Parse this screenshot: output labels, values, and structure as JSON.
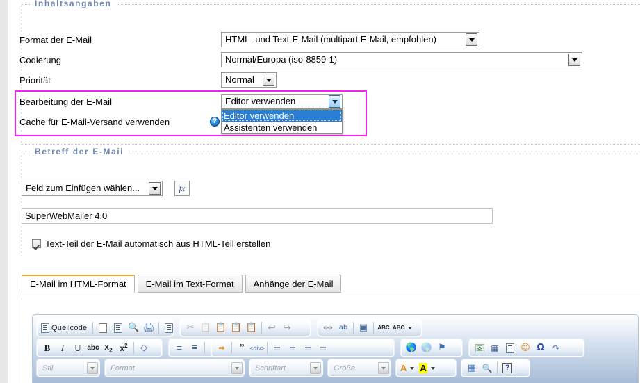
{
  "colors": {
    "legend_text": "#7089ae",
    "highlight_border": "#f51ff5",
    "dropdown_selected_bg": "#2a7fd4",
    "active_tab_top": "#f2a32b",
    "toolbar_gradient_top": "#fdfeff",
    "toolbar_gradient_bottom": "#a7bbd6"
  },
  "sections": {
    "content": {
      "legend": "Inhaltsangaben",
      "rows": [
        {
          "label": "Format der E-Mail",
          "value": "HTML- und Text-E-Mail (multipart E-Mail, empfohlen)"
        },
        {
          "label": "Codierung",
          "value": "Normal/Europa (iso-8859-1)"
        },
        {
          "label": "Priorität",
          "value": "Normal"
        },
        {
          "label": "Bearbeitung der E-Mail",
          "value": "Editor verwenden"
        },
        {
          "label": "Cache für E-Mail-Versand verwenden",
          "value": ""
        }
      ],
      "help_icon": "help-icon",
      "help_glyph": "?",
      "open_dropdown": {
        "selected": "Editor verwenden",
        "options": [
          "Editor verwenden",
          "Assistenten verwenden"
        ]
      }
    },
    "subject": {
      "legend": "Betreff der E-Mail",
      "field_select": {
        "value": "Feld zum Einfügen wählen...",
        "placeholder": "Feld zum Einfügen wählen..."
      },
      "fx_button_label": "fx",
      "subject_input": {
        "value": "SuperWebMailer 4.0",
        "placeholder": ""
      },
      "checkbox": {
        "label": "Text-Teil der E-Mail automatisch aus HTML-Teil erstellen",
        "checked": true
      }
    }
  },
  "tabs": [
    {
      "label": "E-Mail im HTML-Format",
      "active": true
    },
    {
      "label": "E-Mail im Text-Format",
      "active": false
    },
    {
      "label": "Anhänge der E-Mail",
      "active": false
    }
  ],
  "editor_toolbar": {
    "row1": {
      "group1": {
        "source_label": "Quellcode",
        "buttons": [
          "source-icon",
          "new-page-icon",
          "templates-icon",
          "preview-icon",
          "print-icon",
          "document-properties-icon"
        ]
      },
      "group2": {
        "buttons": [
          "cut-icon",
          "copy-icon",
          "paste-icon",
          "paste-text-icon",
          "paste-from-word-icon",
          "undo-icon",
          "redo-icon"
        ]
      },
      "group3": {
        "buttons": [
          "find-icon",
          "replace-icon",
          "select-all-icon",
          "spellcheck-icon",
          "spellcheck-as-you-type-icon"
        ]
      }
    },
    "row2": {
      "group1": {
        "bold": "B",
        "italic": "I",
        "underline": "U",
        "strike": "abc",
        "subscript_base": "x",
        "subscript_sup": "2",
        "superscript_base": "x",
        "superscript_sup": "2",
        "remove_format": "remove-format-icon"
      },
      "group2": {
        "buttons": [
          "numbered-list-icon",
          "bulleted-list-icon",
          "decrease-indent-icon",
          "increase-indent-icon"
        ]
      },
      "group3": {
        "buttons": [
          "outdent-icon",
          "blockquote-icon",
          "create-div-icon",
          "align-left-icon",
          "align-center-icon",
          "align-right-icon",
          "align-justify-icon"
        ]
      },
      "group4": {
        "buttons": [
          "link-icon",
          "unlink-icon",
          "anchor-icon"
        ]
      },
      "group5": {
        "buttons": [
          "image-icon",
          "table-icon",
          "horizontal-rule-icon",
          "smiley-icon",
          "special-char-icon",
          "page-break-icon"
        ]
      }
    },
    "row3": {
      "style_select": "Stil",
      "format_select": "Format",
      "font_select": "Schriftart",
      "size_select": "Größe",
      "text_color": "A",
      "bg_color": "A",
      "buttons": [
        "show-blocks-icon",
        "maximize-icon",
        "about-icon"
      ],
      "about_glyph": "?"
    }
  }
}
